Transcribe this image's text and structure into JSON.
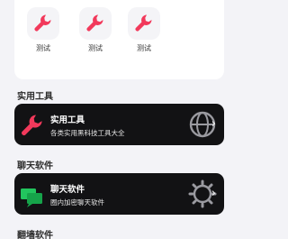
{
  "tools": [
    {
      "label": "测试",
      "icon": "wrench-icon"
    },
    {
      "label": "测试",
      "icon": "wrench-icon"
    },
    {
      "label": "测试",
      "icon": "wrench-icon"
    }
  ],
  "sections": [
    {
      "title": "实用工具",
      "card": {
        "title": "实用工具",
        "subtitle": "各类实用黑科技工具大全",
        "icon": "wrench-icon",
        "deco_icon": "globe-icon"
      }
    },
    {
      "title": "聊天软件",
      "card": {
        "title": "聊天软件",
        "subtitle": "圈内加密聊天软件",
        "icon": "chat-bubbles-icon",
        "deco_icon": "gear-icon"
      }
    },
    {
      "title": "翻墙软件"
    }
  ],
  "colors": {
    "accent": "#f2395b",
    "card_bg": "#121214",
    "chat_green": "#22c55e",
    "page_bg": "#f3f3f7"
  }
}
